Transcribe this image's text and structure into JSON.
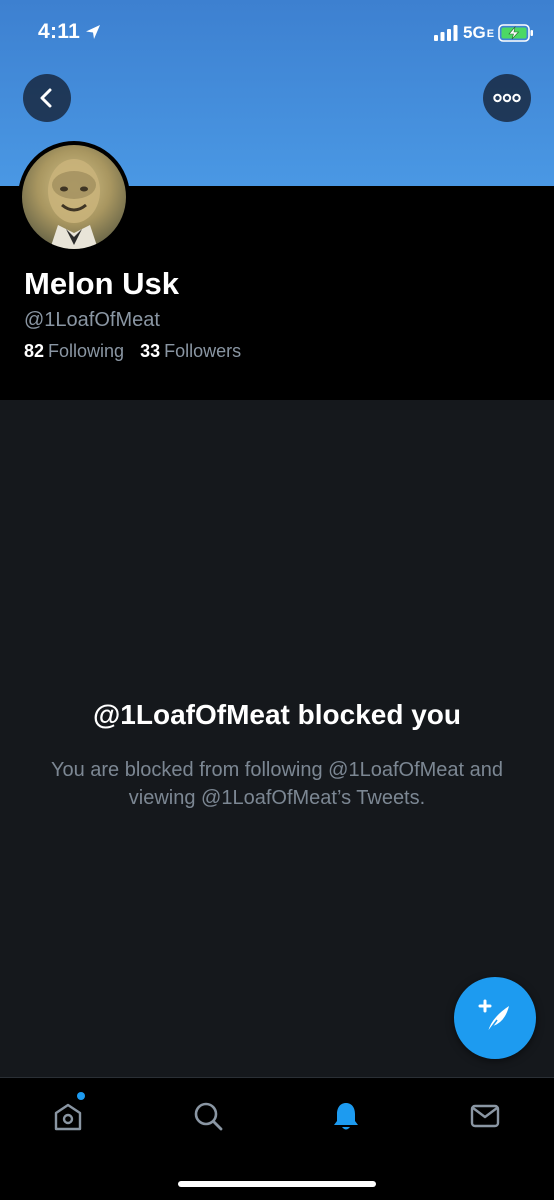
{
  "status_bar": {
    "time": "4:11",
    "network": "5G",
    "network_suffix": "E"
  },
  "profile": {
    "display_name": "Melon Usk",
    "handle": "@1LoafOfMeat",
    "following_count": "82",
    "following_label": "Following",
    "followers_count": "33",
    "followers_label": "Followers"
  },
  "blocked": {
    "title": "@1LoafOfMeat blocked you",
    "message": "You are blocked from following @1LoafOfMeat and viewing @1LoafOfMeat’s Tweets."
  },
  "icons": {
    "back": "chevron-left-icon",
    "more": "more-horizontal-icon",
    "compose": "compose-tweet-icon",
    "home": "home-icon",
    "search": "search-icon",
    "notifications": "bell-icon",
    "messages": "envelope-icon"
  },
  "colors": {
    "accent": "#1d9bf0",
    "banner": "#4a98e4",
    "background": "#15181c",
    "secondary_text": "#8a96a3"
  }
}
